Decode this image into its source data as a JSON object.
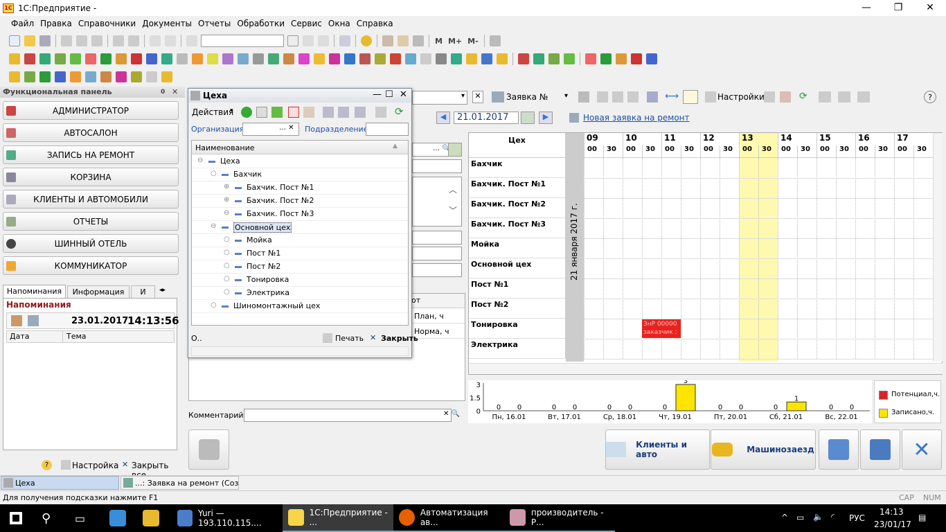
{
  "window": {
    "title": "1С:Предприятие -",
    "min": "—",
    "max": "❐",
    "close": "✕"
  },
  "menu": [
    "Файл",
    "Правка",
    "Справочники",
    "Документы",
    "Отчеты",
    "Обработки",
    "Сервис",
    "Окна",
    "Справка"
  ],
  "toolbar1": {
    "m": "M",
    "mplus": "M+",
    "mminus": "M-"
  },
  "func_panel": {
    "title": "Функциональная панель",
    "pin": "0",
    "close": "✕",
    "items": [
      "АДМИНИСТРАТОР",
      "АВТОСАЛОН",
      "ЗАПИСЬ НА РЕМОНТ",
      "КОРЗИНА",
      "КЛИЕНТЫ И АВТОМОБИЛИ",
      "ОТЧЕТЫ",
      "ШИННЫЙ ОТЕЛЬ",
      "КОММУНИКАТОР"
    ]
  },
  "reminders": {
    "tabs": [
      "Напоминания",
      "Информация",
      "И"
    ],
    "heading": "Напоминания",
    "date": "23.01.2017",
    "time": "14:13:56",
    "col_date": "Дата",
    "col_theme": "Тема"
  },
  "bottom_left": {
    "help": "?",
    "settings": "Настройка",
    "close_all": "Закрыть все"
  },
  "tsekha": {
    "title": "Цеха",
    "actions": "Действия",
    "org_label": "Организация:",
    "dept_label": "Подразделение:",
    "col_name": "Наименование",
    "tree": [
      {
        "label": "Цеха",
        "level": 0,
        "marker": "⊖"
      },
      {
        "label": "Бахчик",
        "level": 1,
        "marker": "○"
      },
      {
        "label": "Бахчик. Пост №1",
        "level": 2,
        "marker": "⊕"
      },
      {
        "label": "Бахчик. Пост №2",
        "level": 2,
        "marker": "⊕"
      },
      {
        "label": "Бахчик. Пост №3",
        "level": 2,
        "marker": "⊖"
      },
      {
        "label": "Основной цех",
        "level": 1,
        "marker": "⊖",
        "selected": true
      },
      {
        "label": "Мойка",
        "level": 2,
        "marker": "○"
      },
      {
        "label": "Пост №1",
        "level": 2,
        "marker": "○"
      },
      {
        "label": "Пост №2",
        "level": 2,
        "marker": "○"
      },
      {
        "label": "Тонировка",
        "level": 2,
        "marker": "○"
      },
      {
        "label": "Электрика",
        "level": 2,
        "marker": "○"
      },
      {
        "label": "Шиномонтажный цех",
        "level": 1,
        "marker": "○"
      }
    ],
    "ok_label": "О..",
    "print": "Печать",
    "close": "Закрыть"
  },
  "main": {
    "order_label": "Заявка №",
    "settings": "Настройки",
    "date": "21.01.2017",
    "new_order": "Новая заявка на ремонт",
    "col_plan": "План, ч",
    "col_norm": "Норма, ч",
    "col_ot": "от",
    "comment_label": "Комментарий:"
  },
  "schedule": {
    "col_header": "Цех",
    "vertical_date": "21 января 2017 г.",
    "hours": [
      "09",
      "10",
      "11",
      "12",
      "13",
      "14",
      "15",
      "16",
      "17"
    ],
    "half": [
      "00",
      "30"
    ],
    "rows": [
      "Бахчик",
      "Бахчик. Пост №1",
      "Бахчик. Пост №2",
      "Бахчик. Пост №3",
      "Мойка",
      "Основной цех",
      "Пост №1",
      "Пост №2",
      "Тонировка",
      "Электрика"
    ],
    "event": {
      "line1": "ЗнР 00000",
      "line2": "заказчик :"
    }
  },
  "weekchart": {
    "y_ticks": [
      "3",
      "1.5",
      "0"
    ],
    "days": [
      "Пн, 16.01",
      "Вт, 17.01",
      "Ср, 18.01",
      "Чт, 19.01",
      "Пт, 20.01",
      "Сб, 21.01",
      "Вс, 22.01"
    ],
    "potential": [
      0,
      0,
      0,
      0,
      0,
      0,
      0
    ],
    "recorded": [
      0,
      0,
      0,
      3,
      0,
      1,
      0
    ],
    "legend": [
      "Потенциал,ч.",
      "Записано,ч."
    ],
    "colors": {
      "potential": "#d9252a",
      "recorded": "#ffe400"
    }
  },
  "buttons": {
    "clients": "Клиенты и авто",
    "arrival": "Машинозаезд"
  },
  "windows_bar": {
    "tab1": "Цеха",
    "tab2": "...: Заявка на ремонт (Созд..."
  },
  "status": {
    "hint": "Для получения подсказки нажмите F1",
    "cap": "CAP",
    "num": "NUM"
  },
  "taskbar": {
    "items": [
      "Yuri — 193.110.115....",
      "1С:Предприятие - ...",
      "Автоматизация ав...",
      "производитель - Р..."
    ],
    "lang": "РУС",
    "time": "14:13",
    "date": "23/01/17"
  }
}
